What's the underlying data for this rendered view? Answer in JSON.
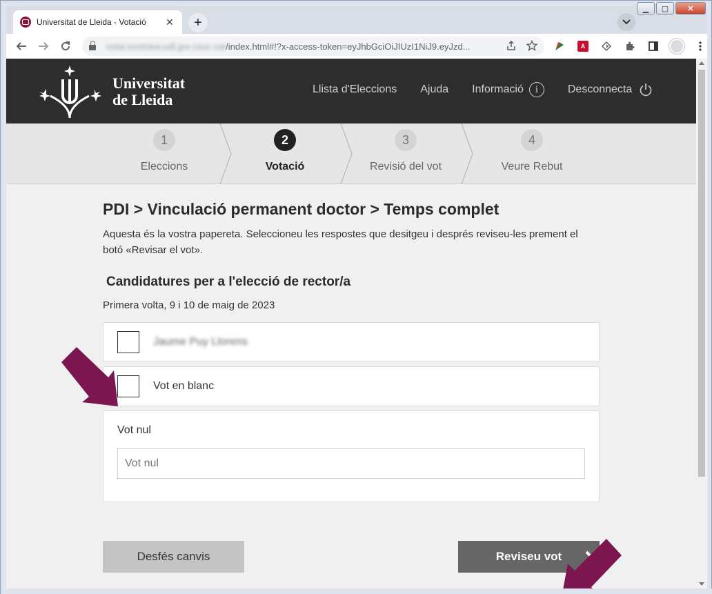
{
  "browser": {
    "tab_title": "Universitat de Lleida - Votació",
    "tab_close": "✕",
    "new_tab": "+",
    "url_host": "votar.evotnew.udl.gre.csuc.cat",
    "url_path": "/index.html#!?x-access-token=eyJhbGciOiJIUzI1NiJ9.eyJzd...",
    "pdf_ext": "A"
  },
  "header": {
    "logo_line1": "Universitat",
    "logo_line2": "de Lleida",
    "nav": {
      "elections": "Llista d'Eleccions",
      "help": "Ajuda",
      "info": "Informació",
      "info_icon": "i",
      "logout": "Desconnecta"
    }
  },
  "steps": [
    {
      "num": "1",
      "label": "Eleccions",
      "active": false
    },
    {
      "num": "2",
      "label": "Votació",
      "active": true
    },
    {
      "num": "3",
      "label": "Revisió del vot",
      "active": false
    },
    {
      "num": "4",
      "label": "Veure Rebut",
      "active": false
    }
  ],
  "ballot": {
    "title": "PDI > Vinculació permanent doctor > Temps complet",
    "description": "Aquesta és la vostra papereta. Seleccioneu les respostes que desitgeu i després reviseu-les prement el botó «Revisar el vot».",
    "section_title": "Candidatures per a l'elecció de rector/a",
    "section_subtitle": "Primera volta, 9 i 10 de maig de 2023",
    "options": [
      {
        "label": "Jaume Puy Llorens",
        "blurred": true
      },
      {
        "label": "Vot en blanc",
        "blurred": false
      }
    ],
    "null_vote": {
      "label": "Vot nul",
      "placeholder": "Vot nul"
    }
  },
  "buttons": {
    "undo": "Desfés canvis",
    "review": "Reviseu vot"
  },
  "colors": {
    "header_bg": "#2d2d2d",
    "annotation_arrow": "#7b1650",
    "review_button": "#666666"
  }
}
